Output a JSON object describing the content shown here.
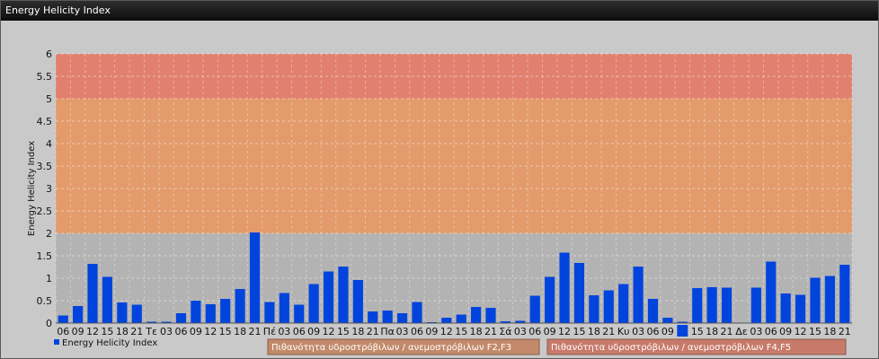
{
  "window": {
    "title": "Energy Helicity Index"
  },
  "colors": {
    "series": "#0044dd",
    "band_low": "#b3b3b3",
    "band_mid": "#e39b6c",
    "band_high": "#e2806f",
    "legend_f23": "#c28a6a",
    "legend_f45": "#c77a6a"
  },
  "chart_data": {
    "type": "bar",
    "title": "",
    "ylabel": "Energy Helicity Index",
    "xlabel": "",
    "ylim": [
      0,
      6
    ],
    "yticks": [
      "0",
      "0.5",
      "1",
      "1.5",
      "2",
      "2.5",
      "3",
      "3.5",
      "4",
      "4.5",
      "5",
      "5.5",
      "6"
    ],
    "grid": true,
    "legend_position": "bottom-left",
    "bands": [
      {
        "from": 0,
        "to": 2,
        "color": "#b3b3b3"
      },
      {
        "from": 2,
        "to": 5,
        "color": "#e39b6c",
        "name": "Πιθανότητα υδροστρόβιλων / ανεμοστρόβιλων F2,F3"
      },
      {
        "from": 5,
        "to": 6,
        "color": "#e2806f",
        "name": "Πιθανότητα υδροστρόβιλων / ανεμοστρόβιλων F4,F5"
      }
    ],
    "categories": [
      "06",
      "09",
      "12",
      "15",
      "18",
      "21",
      "Τε",
      "03",
      "06",
      "09",
      "12",
      "15",
      "18",
      "21",
      "Πέ",
      "03",
      "06",
      "09",
      "12",
      "15",
      "18",
      "21",
      "Πα",
      "03",
      "06",
      "09",
      "12",
      "15",
      "18",
      "21",
      "Σά",
      "03",
      "06",
      "09",
      "12",
      "15",
      "18",
      "21",
      "Κυ",
      "03",
      "06",
      "09",
      "",
      "15",
      "18",
      "21",
      "Δε",
      "03",
      "06",
      "09",
      "12",
      "15",
      "18",
      "21"
    ],
    "series": [
      {
        "name": "Energy Helicity Index",
        "color": "#0044dd",
        "values": [
          0.17,
          0.38,
          1.32,
          1.03,
          0.46,
          0.41,
          0.03,
          0.03,
          0.22,
          0.5,
          0.42,
          0.54,
          0.76,
          2.02,
          0.47,
          0.67,
          0.41,
          0.87,
          1.15,
          1.26,
          0.96,
          0.26,
          0.28,
          0.22,
          0.47,
          0.02,
          0.12,
          0.19,
          0.36,
          0.34,
          0.04,
          0.05,
          0.61,
          1.03,
          1.57,
          1.34,
          0.62,
          0.73,
          0.87,
          1.26,
          0.54,
          0.12,
          0.03,
          0.78,
          0.8,
          0.79,
          0.01,
          0.79,
          1.37,
          0.66,
          0.63,
          1.01,
          1.05,
          1.3
        ]
      }
    ]
  }
}
